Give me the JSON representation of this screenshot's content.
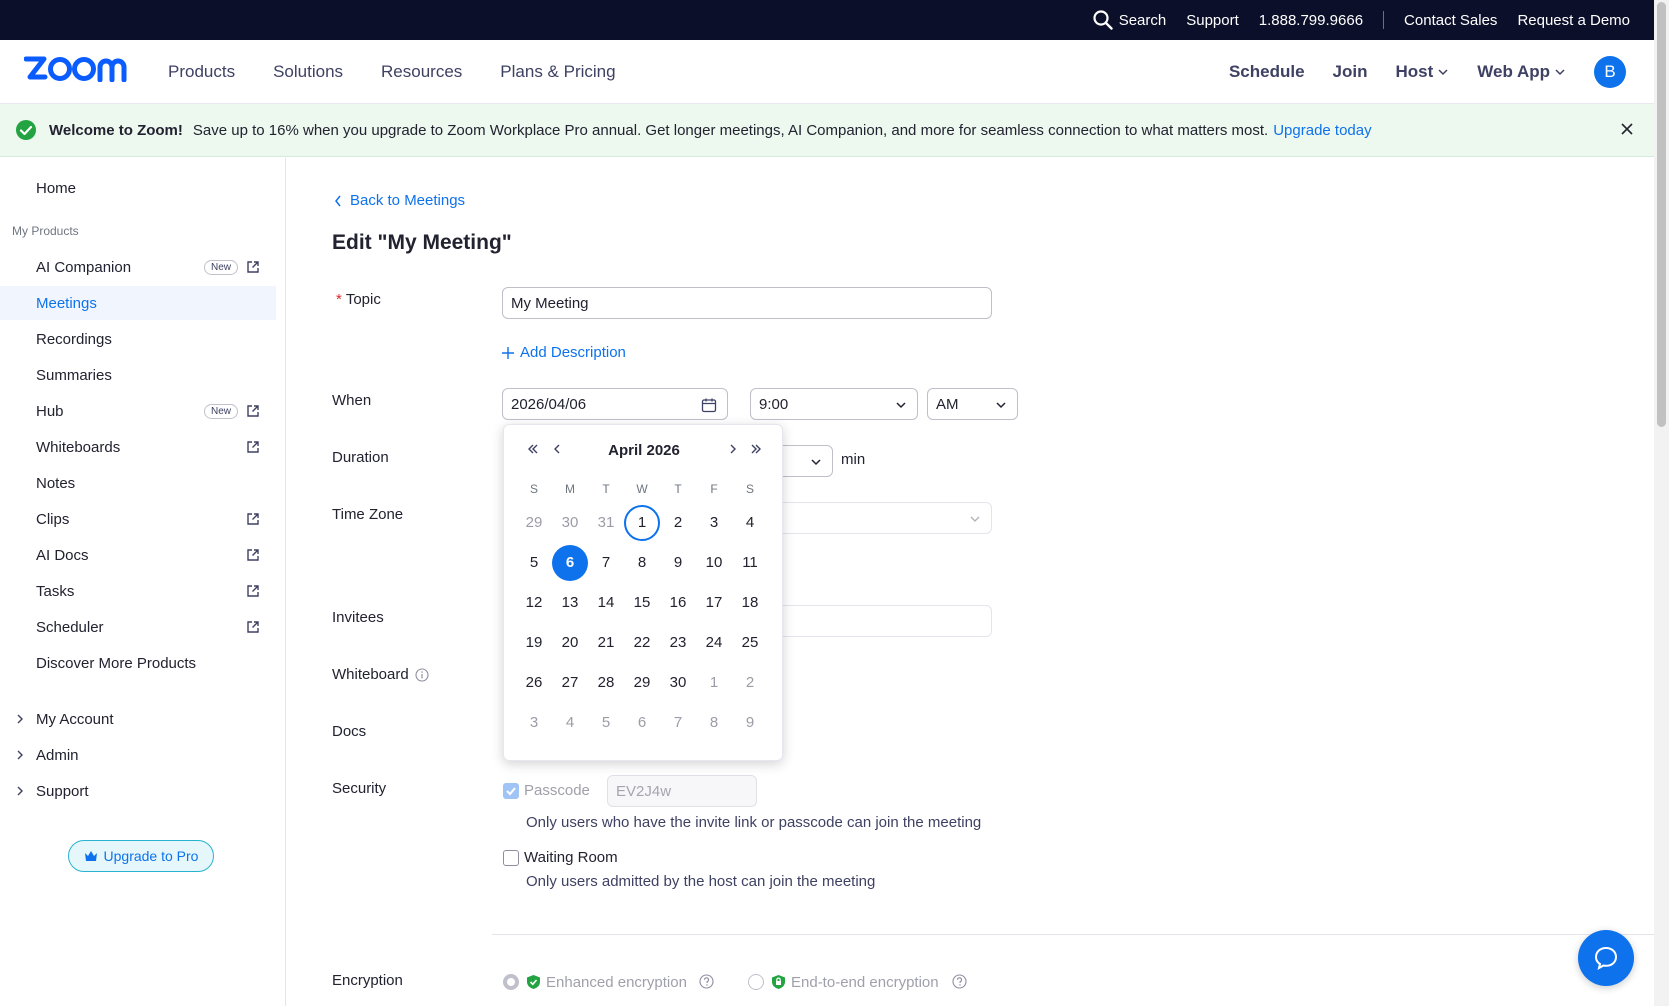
{
  "utilbar": {
    "search": "Search",
    "support": "Support",
    "phone": "1.888.799.9666",
    "contact_sales": "Contact Sales",
    "request_demo": "Request a Demo"
  },
  "nav": {
    "products": "Products",
    "solutions": "Solutions",
    "resources": "Resources",
    "plans": "Plans & Pricing",
    "schedule": "Schedule",
    "join": "Join",
    "host": "Host",
    "webapp": "Web App",
    "avatar_initial": "B"
  },
  "banner": {
    "title": "Welcome to Zoom!",
    "message": "Save up to 16% when you upgrade to Zoom Workplace Pro annual. Get longer meetings, AI Companion, and more for seamless connection to what matters most.",
    "link": "Upgrade today"
  },
  "sidebar": {
    "home": "Home",
    "section_label": "My Products",
    "items": [
      {
        "label": "AI Companion",
        "badge": "New",
        "external": true
      },
      {
        "label": "Meetings",
        "badge": "",
        "external": false,
        "active": true
      },
      {
        "label": "Recordings",
        "badge": "",
        "external": false
      },
      {
        "label": "Summaries",
        "badge": "",
        "external": false
      },
      {
        "label": "Hub",
        "badge": "New",
        "external": true
      },
      {
        "label": "Whiteboards",
        "badge": "",
        "external": true
      },
      {
        "label": "Notes",
        "badge": "",
        "external": false
      },
      {
        "label": "Clips",
        "badge": "",
        "external": true
      },
      {
        "label": "AI Docs",
        "badge": "",
        "external": true
      },
      {
        "label": "Tasks",
        "badge": "",
        "external": true
      },
      {
        "label": "Scheduler",
        "badge": "",
        "external": true
      },
      {
        "label": "Discover More Products",
        "badge": "",
        "external": false
      }
    ],
    "my_account": "My Account",
    "admin": "Admin",
    "support": "Support",
    "upgrade": "Upgrade to Pro"
  },
  "form": {
    "back": "Back to Meetings",
    "title": "Edit \"My Meeting\"",
    "topic_label": "Topic",
    "topic_value": "My Meeting",
    "add_description": "Add Description",
    "when_label": "When",
    "date_value": "2026/04/06",
    "time_value": "9:00",
    "ampm_value": "AM",
    "duration_label": "Duration",
    "min_label": "min",
    "timezone_label": "Time Zone",
    "invitees_label": "Invitees",
    "whiteboard_label": "Whiteboard",
    "docs_label": "Docs",
    "security_label": "Security",
    "passcode_label": "Passcode",
    "passcode_value": "EV2J4w",
    "passcode_help": "Only users who have the invite link or passcode can join the meeting",
    "waiting_room_label": "Waiting Room",
    "waiting_room_help": "Only users admitted by the host can join the meeting",
    "encryption_label": "Encryption",
    "enhanced_encryption": "Enhanced encryption",
    "e2e_encryption": "End-to-end encryption"
  },
  "calendar": {
    "month": "April 2026",
    "dow": [
      "S",
      "M",
      "T",
      "W",
      "T",
      "F",
      "S"
    ],
    "weeks": [
      [
        "29",
        "30",
        "31",
        "1",
        "2",
        "3",
        "4"
      ],
      [
        "5",
        "6",
        "7",
        "8",
        "9",
        "10",
        "11"
      ],
      [
        "12",
        "13",
        "14",
        "15",
        "16",
        "17",
        "18"
      ],
      [
        "19",
        "20",
        "21",
        "22",
        "23",
        "24",
        "25"
      ],
      [
        "26",
        "27",
        "28",
        "29",
        "30",
        "1",
        "2"
      ],
      [
        "3",
        "4",
        "5",
        "6",
        "7",
        "8",
        "9"
      ]
    ],
    "today": "1",
    "selected": "6"
  },
  "colors": {
    "accent": "#0e72ed",
    "topbar": "#0b0f29",
    "banner_bg": "#edf8ef",
    "success_green": "#23a342"
  }
}
